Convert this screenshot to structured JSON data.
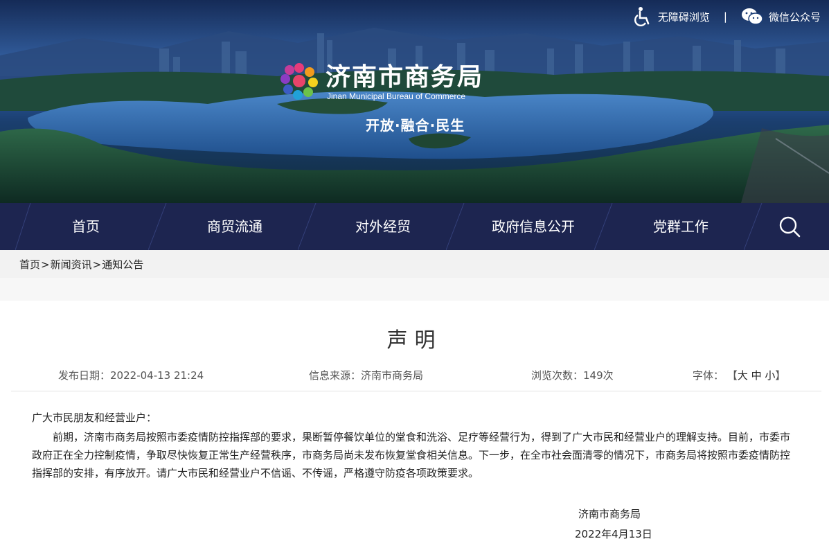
{
  "top_links": {
    "accessibility": "无障碍浏览",
    "separator": "|",
    "wechat": "微信公众号"
  },
  "logo": {
    "title": "济南市商务局",
    "subtitle": "Jinan Municipal Bureau of Commerce"
  },
  "slogan": "开放·融合·民生",
  "nav": {
    "items": [
      {
        "label": "首页"
      },
      {
        "label": "商贸流通"
      },
      {
        "label": "对外经贸"
      },
      {
        "label": "政府信息公开"
      },
      {
        "label": "党群工作"
      }
    ],
    "search_icon": "search-icon"
  },
  "breadcrumb": {
    "home": "首页",
    "news": "新闻资讯",
    "notice": "通知公告",
    "sep": ">"
  },
  "article": {
    "title": "声明",
    "publish_label": "发布日期：",
    "publish_date": "2022-04-13 21:24",
    "source_label": "信息来源：",
    "source": "济南市商务局",
    "views_label": "浏览次数：",
    "views": "149次",
    "font_label": "字体：",
    "font_open": "【",
    "font_large": "大",
    "font_medium": "中",
    "font_small": "小",
    "font_close": "】",
    "greeting": "广大市民朋友和经营业户：",
    "paragraph": "前期，济南市商务局按照市委疫情防控指挥部的要求，果断暂停餐饮单位的堂食和洗浴、足疗等经营行为，得到了广大市民和经营业户的理解支持。目前，市委市政府正在全力控制疫情，争取尽快恢复正常生产经营秩序，市商务局尚未发布恢复堂食相关信息。下一步，在全市社会面清零的情况下，市商务局将按照市委疫情防控指挥部的安排，有序放开。请广大市民和经营业户不信谣、不传谣，严格遵守防疫各项政策要求。",
    "signature": "济南市商务局",
    "date": "2022年4月13日"
  },
  "colors": {
    "nav_bg": "#1d2550",
    "breadcrumb_bg": "#f2f2f2",
    "banner_water": "#2c61a8"
  }
}
